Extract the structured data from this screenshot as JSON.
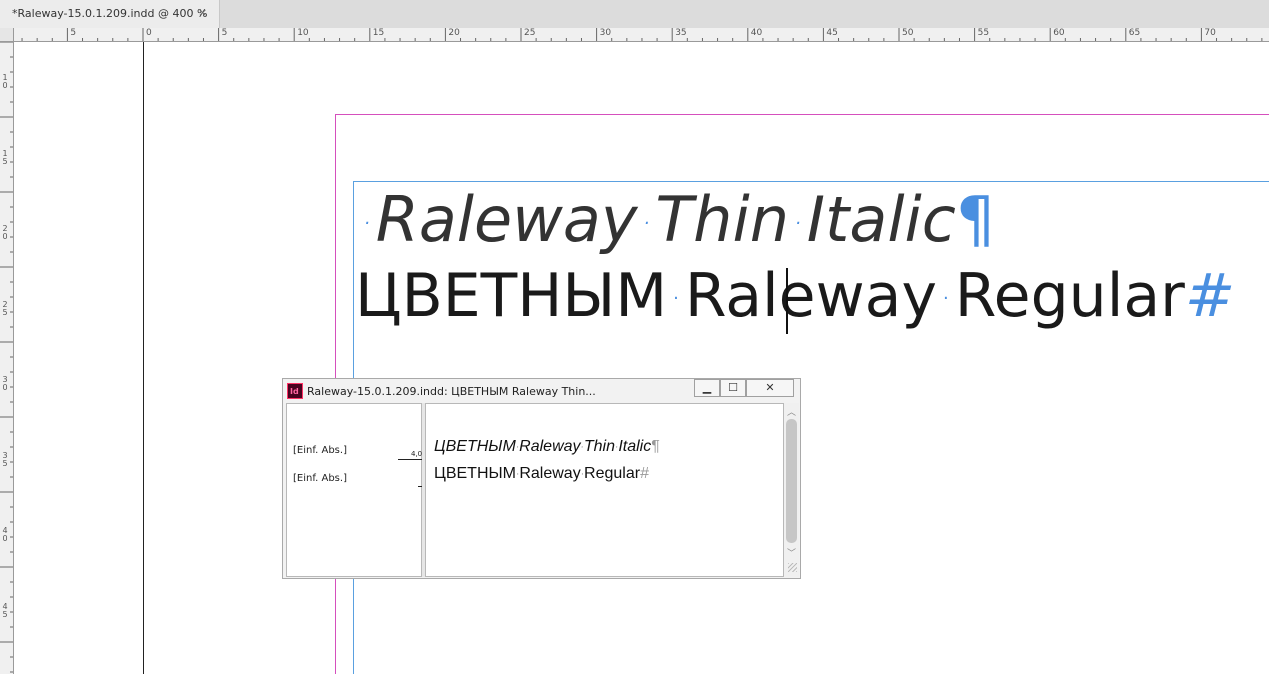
{
  "tab": {
    "title": "*Raleway-15.0.1.209.indd @ 400 %",
    "close_glyph": "×"
  },
  "ruler": {
    "h_labels": [
      "5",
      "0",
      "5",
      "10",
      "15",
      "20",
      "25",
      "30",
      "35",
      "40",
      "45",
      "50",
      "55",
      "60",
      "65",
      "70"
    ],
    "v_labels": [
      "1\n0",
      "1\n5",
      "2\n0",
      "2\n5",
      "3\n0",
      "3\n5",
      "4\n0",
      "4\n5"
    ]
  },
  "document": {
    "line1_words": [
      "Raleway",
      "Thin",
      "Italic"
    ],
    "line1_end_mark": "¶",
    "line2_words": [
      "ЦВЕТНЫМ",
      "Raleway",
      "Regular"
    ],
    "line2_end_mark": "#",
    "space_marker": "·"
  },
  "story_editor": {
    "title": "Raleway-15.0.1.209.indd: ЦВЕТНЫМ Raleway Thin...",
    "app_icon_text": "Id",
    "minimize_glyph": "▁",
    "maximize_glyph": "☐",
    "close_glyph": "✕",
    "styles": [
      {
        "name": "[Einf. Abs.]",
        "depth": "4,0"
      },
      {
        "name": "[Einf. Abs.]",
        "depth": ""
      }
    ],
    "line1_words": [
      "ЦВЕТНЫМ",
      "Raleway",
      "Thin",
      "Italic"
    ],
    "line1_end_mark": "¶",
    "line2_words": [
      "ЦВЕТНЫМ",
      "Raleway",
      "Regular"
    ],
    "line2_end_mark": "#",
    "space_marker": "·",
    "scroll_up_glyph": "︿",
    "scroll_down_glyph": "﹀"
  },
  "colors": {
    "margin_guide": "#d54fbd",
    "frame_edge": "#5aa0e0",
    "hidden_chars": "#4a8fe0"
  }
}
